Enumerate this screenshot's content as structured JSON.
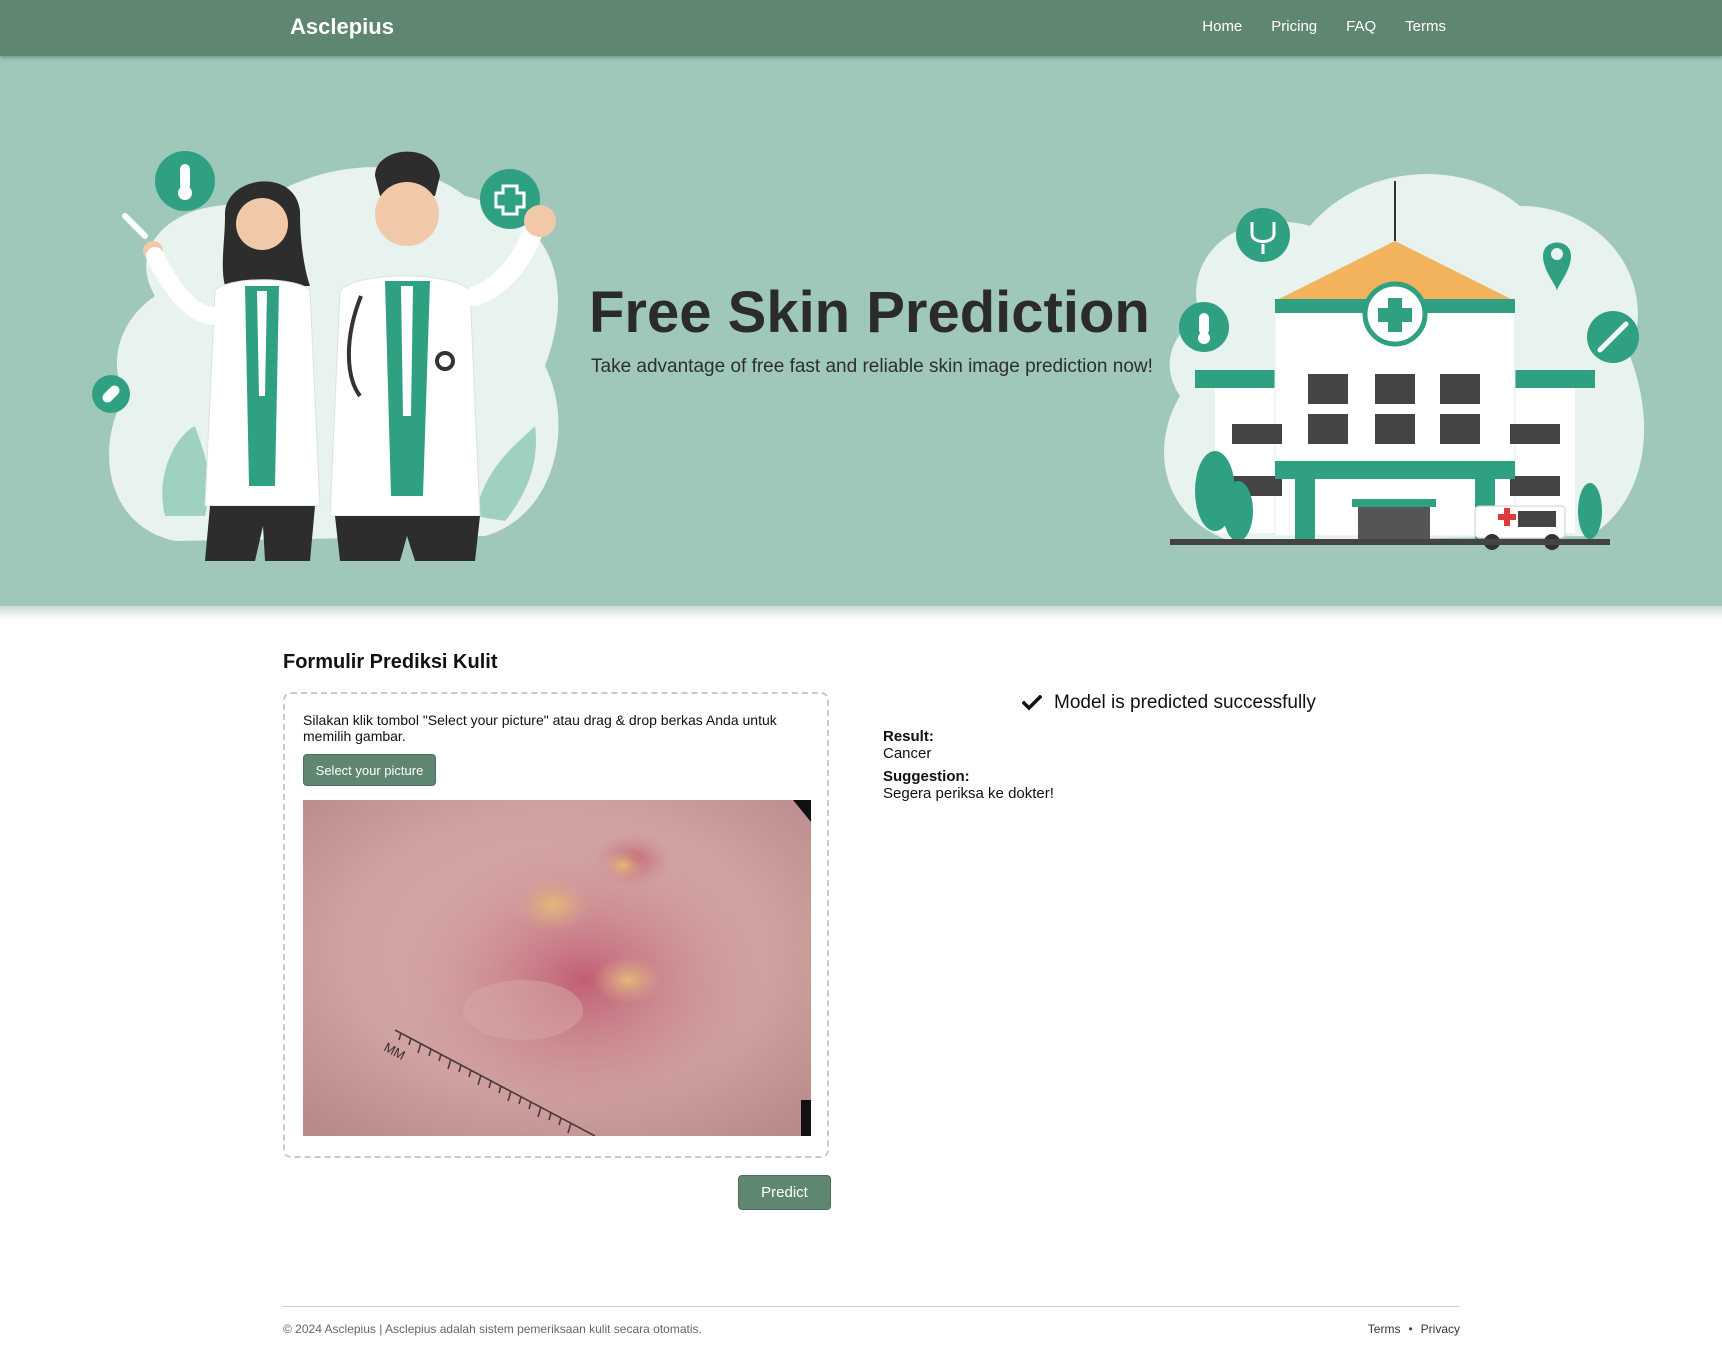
{
  "navbar": {
    "brand": "Asclepius",
    "links": [
      "Home",
      "Pricing",
      "FAQ",
      "Terms"
    ]
  },
  "hero": {
    "title": "Free Skin Prediction",
    "subtitle": "Take advantage of free fast and reliable skin image prediction now!"
  },
  "form": {
    "title": "Formulir Prediksi Kulit",
    "instructions": "Silakan klik tombol \"Select your picture\" atau drag & drop berkas Anda untuk memilih gambar.",
    "select_label": "Select your picture",
    "ruler_text": "MM",
    "predict_label": "Predict"
  },
  "result": {
    "status": "Model is predicted successfully",
    "result_label": "Result:",
    "result_value": "Cancer",
    "suggestion_label": "Suggestion:",
    "suggestion_value": "Segera periksa ke dokter!"
  },
  "footer": {
    "copyright": "© 2024 Asclepius | Asclepius adalah sistem pemeriksaan kulit secara otomatis.",
    "links": [
      "Terms",
      "Privacy"
    ],
    "separator": "•"
  },
  "colors": {
    "nav": "#5e8670",
    "hero": "#9fc8ba",
    "accent": "#2fa082"
  }
}
